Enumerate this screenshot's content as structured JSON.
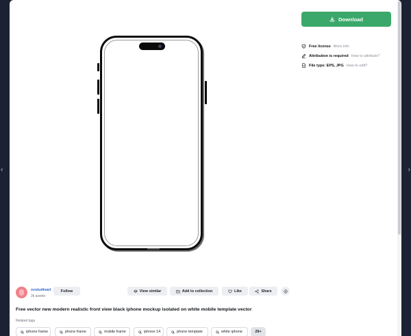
{
  "nav": {
    "prev_arrow": "‹",
    "next_arrow": "›"
  },
  "download": {
    "label": "Download",
    "color": "#3aa86a"
  },
  "license": {
    "free_license_label": "Free license",
    "free_license_link": "More info",
    "attribution_label": "Attribution is required",
    "attribution_link": "How to attribute?",
    "file_type_label": "File type: EPS, JPG",
    "file_type_link": "How to edit?"
  },
  "author": {
    "name": "svstudioart",
    "assets": "2k assets",
    "follow_label": "Follow"
  },
  "actions": {
    "view_similar": "View similar",
    "add_to_collection": "Add to collection",
    "like": "Like",
    "share": "Share"
  },
  "resource": {
    "title": "Free vector new modern realistic front view black iphone mockup isolated on white mobile template vector",
    "related_tags_heading": "Related tags"
  },
  "tags": [
    "iphone frame",
    "phone frame",
    "mobile frame",
    "iphone 14",
    "phone template",
    "white iphone"
  ],
  "tags_more": "29+"
}
